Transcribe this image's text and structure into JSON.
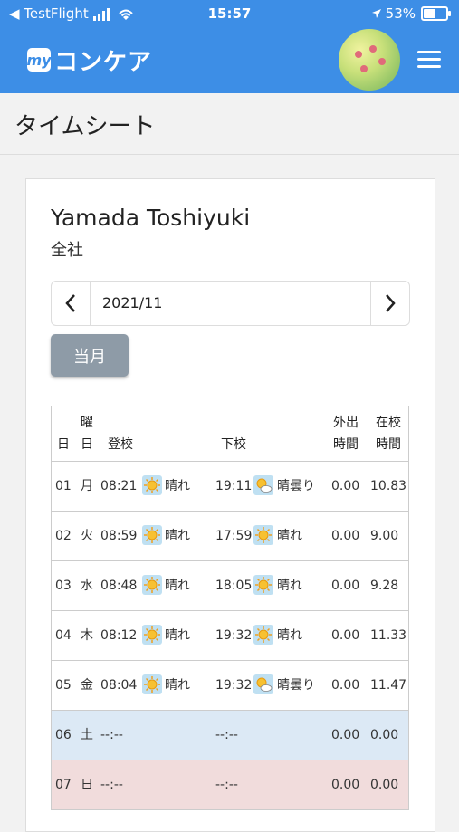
{
  "status": {
    "back_app": "◀ TestFlight",
    "time": "15:57",
    "battery": "53%",
    "battery_level": 0.53
  },
  "app": {
    "logo_badge": "my",
    "logo_text": "コンケア"
  },
  "page": {
    "title": "タイムシート"
  },
  "user": {
    "name": "Yamada Toshiyuki",
    "dept": "全社"
  },
  "month": {
    "value": "2021/11",
    "current_button": "当月"
  },
  "table": {
    "headers": {
      "day": "日",
      "weekday_line1": "曜",
      "weekday_line2": "日",
      "in": "登校",
      "out": "下校",
      "outing_line1": "外出",
      "outing_line2": "時間",
      "school_line1": "在校",
      "school_line2": "時間"
    },
    "rows": [
      {
        "day": "01",
        "wd": "月",
        "in": "08:21",
        "in_weather": "晴れ",
        "out": "19:11",
        "out_weather": "晴曇り",
        "outing": "0.00",
        "school": "10.83",
        "in_icon": "sun-icon",
        "out_icon": "sun-cloud-icon"
      },
      {
        "day": "02",
        "wd": "火",
        "in": "08:59",
        "in_weather": "晴れ",
        "out": "17:59",
        "out_weather": "晴れ",
        "outing": "0.00",
        "school": "9.00",
        "in_icon": "sun-icon",
        "out_icon": "sun-icon"
      },
      {
        "day": "03",
        "wd": "水",
        "in": "08:48",
        "in_weather": "晴れ",
        "out": "18:05",
        "out_weather": "晴れ",
        "outing": "0.00",
        "school": "9.28",
        "in_icon": "sun-icon",
        "out_icon": "sun-icon"
      },
      {
        "day": "04",
        "wd": "木",
        "in": "08:12",
        "in_weather": "晴れ",
        "out": "19:32",
        "out_weather": "晴れ",
        "outing": "0.00",
        "school": "11.33",
        "in_icon": "sun-icon",
        "out_icon": "sun-icon"
      },
      {
        "day": "05",
        "wd": "金",
        "in": "08:04",
        "in_weather": "晴れ",
        "out": "19:32",
        "out_weather": "晴曇り",
        "outing": "0.00",
        "school": "11.47",
        "in_icon": "sun-icon",
        "out_icon": "sun-cloud-icon"
      },
      {
        "day": "06",
        "wd": "土",
        "in": "--:--",
        "in_weather": "",
        "out": "--:--",
        "out_weather": "",
        "outing": "0.00",
        "school": "0.00"
      },
      {
        "day": "07",
        "wd": "日",
        "in": "--:--",
        "in_weather": "",
        "out": "--:--",
        "out_weather": "",
        "outing": "0.00",
        "school": "0.00"
      }
    ]
  },
  "colors": {
    "header": "#3d8ee6",
    "saturday": "#dce9f5",
    "sunday": "#f1dcdc"
  }
}
